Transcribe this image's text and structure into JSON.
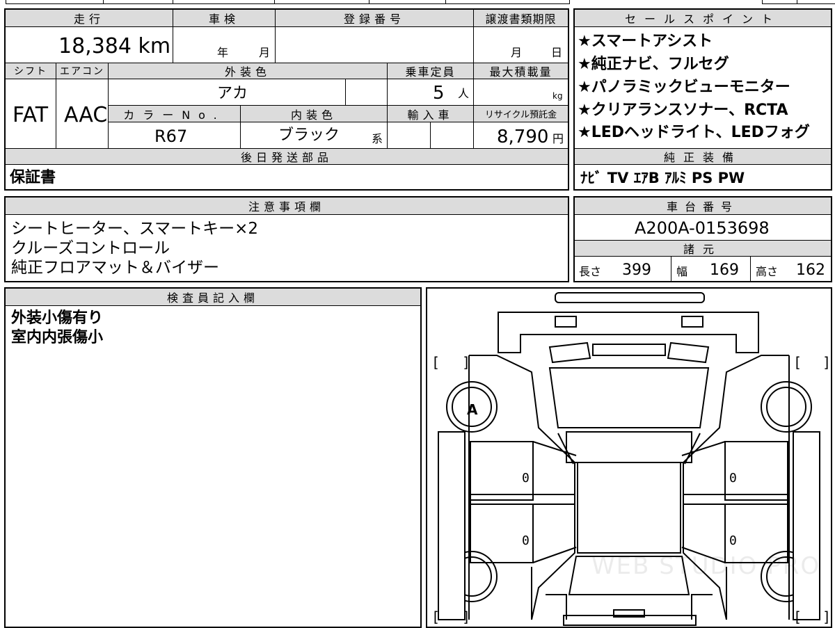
{
  "spec_table": {
    "headers": {
      "mileage": "走行",
      "inspection": "車検",
      "registration_no": "登録番号",
      "transfer_deadline": "譲渡書類期限",
      "shift": "シフト",
      "aircon": "エアコン",
      "exterior_color": "外装色",
      "capacity": "乗車定員",
      "max_load": "最大積載量",
      "color_no": "カラーNo.",
      "interior_color": "内装色",
      "import": "輸入車",
      "recycle_fee": "リサイクル預託金",
      "later_parts": "後日発送部品"
    },
    "values": {
      "mileage": "18,384 km",
      "inspection_year_unit": "年",
      "inspection_month_unit": "月",
      "deadline_month_unit": "月",
      "deadline_day_unit": "日",
      "shift": "FAT",
      "aircon": "AAC",
      "exterior_color": "アカ",
      "capacity": "5",
      "capacity_unit": "人",
      "load_unit": "kg",
      "color_no": "R67",
      "interior_color": "ブラック",
      "interior_suffix": "系",
      "recycle_fee": "8,790",
      "recycle_unit": "円",
      "later_parts": "保証書"
    }
  },
  "sales_points": {
    "header": "セールスポイント",
    "items": [
      "★スマートアシスト",
      "★純正ナビ、フルセグ",
      "★パノラミックビューモニター",
      "★クリアランスソナー、RCTA",
      "★LEDヘッドライト、LEDフォグ"
    ]
  },
  "factory_equipment": {
    "header": "純正装備",
    "value": "ﾅﾋﾞ TV ｴｱB ｱﾙﾐ PS PW"
  },
  "notes": {
    "header": "注意事項欄",
    "lines": [
      "シートヒーター、スマートキー×2",
      "クルーズコントロール",
      "純正フロアマット＆バイザー"
    ]
  },
  "chassis": {
    "header": "車台番号",
    "value": "A200A-0153698"
  },
  "dimensions": {
    "header": "諸元",
    "length_label": "長さ",
    "length": "399",
    "width_label": "幅",
    "width": "169",
    "height_label": "高さ",
    "height": "162"
  },
  "inspector": {
    "header": "検査員記入欄",
    "lines": [
      "外装小傷有り",
      "室内内張傷小"
    ]
  },
  "diagram": {
    "mark_a": "A",
    "zero": "0",
    "bracket_open": "[",
    "bracket_close": "]",
    "watermark": "WEB STUDIO PRO"
  }
}
